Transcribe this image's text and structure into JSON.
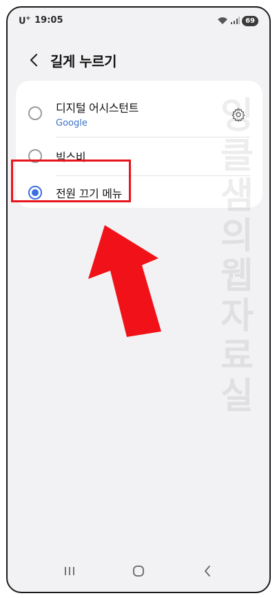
{
  "status": {
    "carrier": "U",
    "carrier_sup": "+",
    "time": "19:05",
    "battery": "69",
    "icons": [
      "wifi-icon",
      "signal-icon",
      "battery-icon"
    ]
  },
  "header": {
    "back_icon": "chevron-left-icon",
    "title": "길게 누르기"
  },
  "options": [
    {
      "label": "디지털 어시스턴트",
      "sublabel": "Google",
      "selected": false,
      "has_settings": true
    },
    {
      "label": "빅스비",
      "selected": false
    },
    {
      "label": "전원 끄기 메뉴",
      "selected": true
    }
  ],
  "watermark": "잉클샘의웹자료실",
  "colors": {
    "accent": "#3b6fe0",
    "sublabel": "#3a73c9",
    "highlight": "#e8141b",
    "arrow": "#f01218",
    "background": "#f2f2f4"
  },
  "navbar": {
    "icons": [
      "recent-apps-icon",
      "home-icon",
      "back-icon"
    ]
  }
}
